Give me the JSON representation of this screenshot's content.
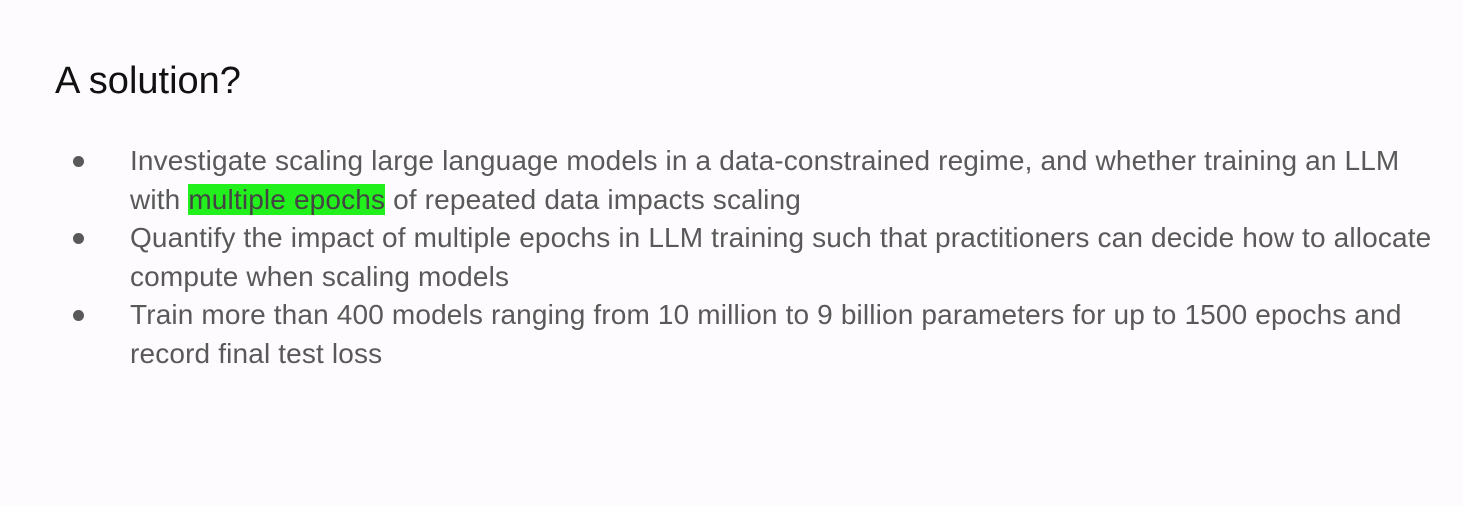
{
  "slide": {
    "title": "A solution?",
    "highlight_color": "#22f01c",
    "bullets": [
      {
        "before": "Investigate scaling large language models in a data-constrained regime, and whether training an LLM with ",
        "highlight": "multiple epochs",
        "after": " of repeated data impacts scaling"
      },
      {
        "text": "Quantify the impact of multiple epochs in LLM training such that practitioners can decide how to allocate compute when scaling models"
      },
      {
        "text": "Train more than 400 models ranging from 10 million to 9 billion parameters for up to 1500 epochs and record final test loss"
      }
    ]
  }
}
